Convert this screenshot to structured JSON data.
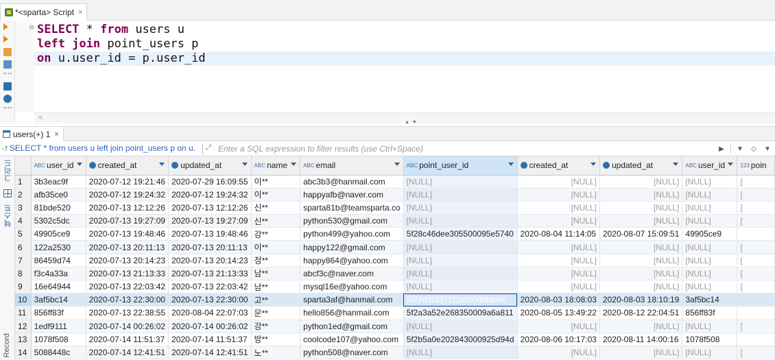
{
  "editor_tab": {
    "title": "*<sparta> Script",
    "close": "×"
  },
  "sql": {
    "line1": {
      "kw1": "SELECT",
      "rest1": " * ",
      "kw2": "from",
      "rest2": " users u"
    },
    "line2": {
      "kw1": "left join",
      "rest1": " point_users p"
    },
    "line3": {
      "kw1": "on",
      "rest1": " u.user_id = p.user_id"
    }
  },
  "results_tab": {
    "title": "users(+) 1",
    "close": "×"
  },
  "filter": {
    "query": "SELECT * from users u left join point_users p on u.",
    "placeholder": "Enter a SQL expression to filter results (use Ctrl+Space)"
  },
  "side_labels": {
    "grid": "그리드",
    "text": "텍스트",
    "record": "Record"
  },
  "columns": [
    {
      "label": "user_id",
      "type": "ABC"
    },
    {
      "label": "created_at",
      "type": "clock"
    },
    {
      "label": "updated_at",
      "type": "clock"
    },
    {
      "label": "name",
      "type": "ABC"
    },
    {
      "label": "email",
      "type": "ABC"
    },
    {
      "label": "point_user_id",
      "type": "ABC"
    },
    {
      "label": "created_at",
      "type": "clock"
    },
    {
      "label": "updated_at",
      "type": "clock"
    },
    {
      "label": "user_id",
      "type": "ABC"
    },
    {
      "label": "poin",
      "type": "123"
    }
  ],
  "rows": [
    [
      "1",
      "3b3eac9f",
      "2020-07-12 19:21:46",
      "2020-07-29 16:09:55",
      "이**",
      "abc3b3@hanmail.com",
      "[NULL]",
      "[NULL]",
      "[NULL]",
      "[NULL]",
      "["
    ],
    [
      "2",
      "afb35ce0",
      "2020-07-12 19:24:32",
      "2020-07-12 19:24:32",
      "이**",
      "happyafb@naver.com",
      "[NULL]",
      "[NULL]",
      "[NULL]",
      "[NULL]",
      "["
    ],
    [
      "3",
      "81bde520",
      "2020-07-13 12:12:26",
      "2020-07-13 12:12:26",
      "신**",
      "sparta81b@teamsparta.co",
      "[NULL]",
      "[NULL]",
      "[NULL]",
      "[NULL]",
      "["
    ],
    [
      "4",
      "5302c5dc",
      "2020-07-13 19:27:09",
      "2020-07-13 19:27:09",
      "신**",
      "python530@gmail.com",
      "[NULL]",
      "[NULL]",
      "[NULL]",
      "[NULL]",
      "["
    ],
    [
      "5",
      "49905ce9",
      "2020-07-13 19:48:46",
      "2020-07-13 19:48:46",
      "강**",
      "python499@yahoo.com",
      "5f28c46dee305500095e5740",
      "2020-08-04 11:14:05",
      "2020-08-07 15:09:51",
      "49905ce9",
      ""
    ],
    [
      "6",
      "122a2530",
      "2020-07-13 20:11:13",
      "2020-07-13 20:11:13",
      "이**",
      "happy122@gmail.com",
      "[NULL]",
      "[NULL]",
      "[NULL]",
      "[NULL]",
      "["
    ],
    [
      "7",
      "86459d74",
      "2020-07-13 20:14:23",
      "2020-07-13 20:14:23",
      "정**",
      "happy864@yahoo.com",
      "[NULL]",
      "[NULL]",
      "[NULL]",
      "[NULL]",
      "["
    ],
    [
      "8",
      "f3c4a33a",
      "2020-07-13 21:13:33",
      "2020-07-13 21:13:33",
      "남**",
      "abcf3c@naver.com",
      "[NULL]",
      "[NULL]",
      "[NULL]",
      "[NULL]",
      "["
    ],
    [
      "9",
      "16e64944",
      "2020-07-13 22:03:42",
      "2020-07-13 22:03:42",
      "남**",
      "mysql16e@yahoo.com",
      "[NULL]",
      "[NULL]",
      "[NULL]",
      "[NULL]",
      "["
    ],
    [
      "10",
      "3af5bc14",
      "2020-07-13 22:30:00",
      "2020-07-13 22:30:00",
      "고**",
      "sparta3af@hanmail.com",
      "5f27d3f3371f2b0009bbb6fc",
      "2020-08-03 18:08:03",
      "2020-08-03 18:10:19",
      "3af5bc14",
      ""
    ],
    [
      "11",
      "856ff83f",
      "2020-07-13 22:38:55",
      "2020-08-04 22:07:03",
      "문**",
      "hello856@hanmail.com",
      "5f2a3a52e268350009a6a811",
      "2020-08-05 13:49:22",
      "2020-08-12 22:04:51",
      "856ff83f",
      ""
    ],
    [
      "12",
      "1edf9111",
      "2020-07-14 00:26:02",
      "2020-07-14 00:26:02",
      "강**",
      "python1ed@gmail.com",
      "[NULL]",
      "[NULL]",
      "[NULL]",
      "[NULL]",
      "["
    ],
    [
      "13",
      "1078f508",
      "2020-07-14 11:51:37",
      "2020-07-14 11:51:37",
      "방**",
      "coolcode107@yahoo.com",
      "5f2b5a0e202843000925d94d",
      "2020-08-06 10:17:03",
      "2020-08-11 14:00:16",
      "1078f508",
      ""
    ],
    [
      "14",
      "5088448c",
      "2020-07-14 12:41:51",
      "2020-07-14 12:41:51",
      "노**",
      "python508@naver.com",
      "[NULL]",
      "[NULL]",
      "[NULL]",
      "[NULL]",
      "["
    ]
  ],
  "selected_row_index": 9,
  "selected_col_index": 6
}
